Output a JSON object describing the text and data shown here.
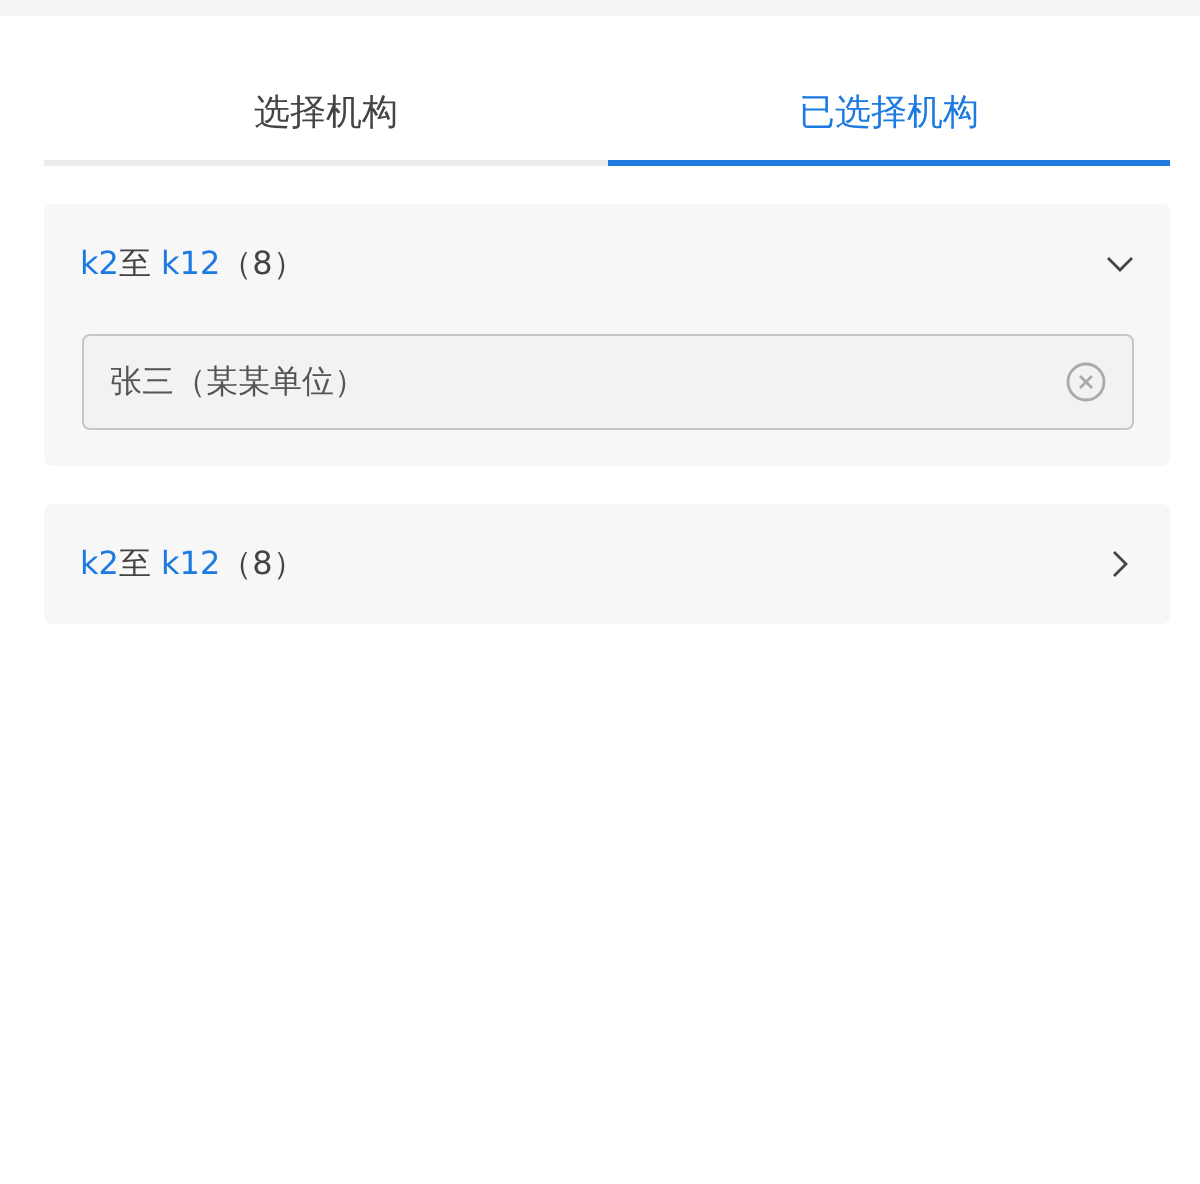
{
  "tabs": [
    {
      "label": "选择机构",
      "selected": false
    },
    {
      "label": "已选择机构",
      "selected": true
    }
  ],
  "groups": [
    {
      "from": "k2",
      "sep": "至",
      "to": "k12",
      "count": "（8）",
      "expanded": true,
      "items": [
        {
          "label": "张三（某某单位）"
        }
      ]
    },
    {
      "from": "k2",
      "sep": "至",
      "to": "k12",
      "count": "（8）",
      "expanded": false
    }
  ]
}
